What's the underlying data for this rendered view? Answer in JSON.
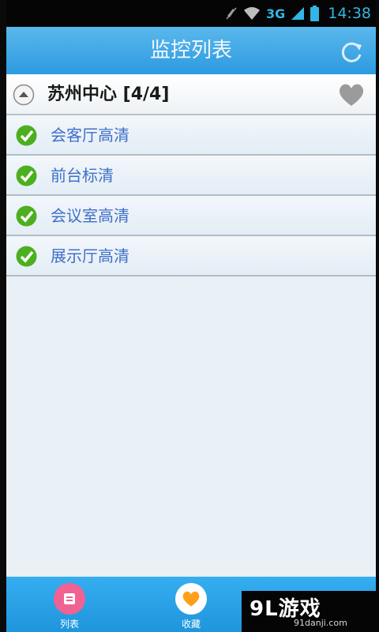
{
  "status_bar": {
    "network": "3G",
    "time": "14:38",
    "icons": [
      "mute-icon",
      "wifi-icon",
      "signal-icon",
      "battery-icon"
    ],
    "accent_color": "#33b5e5"
  },
  "header": {
    "title": "监控列表",
    "refresh_icon": "refresh-icon"
  },
  "group": {
    "title": "苏州中心 [4/4]",
    "collapse_icon": "collapse-up-icon",
    "favorite_icon": "heart-icon"
  },
  "cameras": [
    {
      "name": "会客厅高清",
      "status_icon": "check-icon"
    },
    {
      "name": "前台标清",
      "status_icon": "check-icon"
    },
    {
      "name": "会议室高清",
      "status_icon": "check-icon"
    },
    {
      "name": "展示厅高清",
      "status_icon": "check-icon"
    }
  ],
  "bottom_nav": [
    {
      "label": "列表",
      "icon": "list-icon",
      "color": "#f06292"
    },
    {
      "label": "收藏",
      "icon": "heart-icon",
      "color": "#ff9f1a"
    }
  ],
  "watermark": {
    "logo": "9L游戏",
    "url": "91danji.com"
  },
  "colors": {
    "title_bar": "#2d9ae0",
    "link_text": "#3f6fc8",
    "check_green": "#4caf1f"
  }
}
